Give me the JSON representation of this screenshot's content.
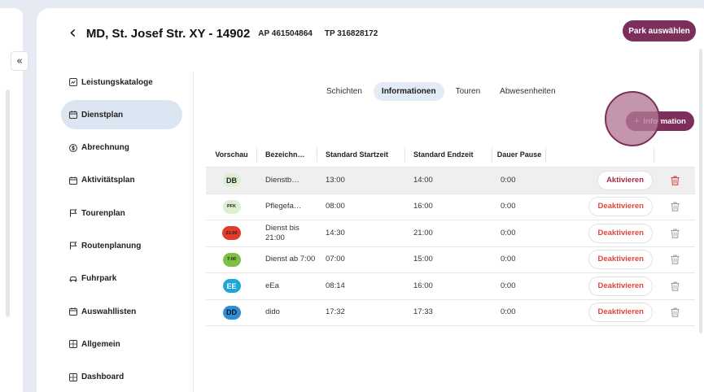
{
  "header": {
    "title": "MD, St. Josef Str. XY - 14902",
    "ap": "AP 461504864",
    "tp": "TP 316828172",
    "park_button": "Park auswählen"
  },
  "collapse_label": "«",
  "back_label": "‹",
  "sidebar": {
    "items": [
      {
        "label": "Leistungskataloge",
        "icon": "catalog-icon",
        "active": false
      },
      {
        "label": "Dienstplan",
        "icon": "calendar-icon",
        "active": true
      },
      {
        "label": "Abrechnung",
        "icon": "dollar-icon",
        "active": false
      },
      {
        "label": "Aktivitätsplan",
        "icon": "calendar-icon",
        "active": false
      },
      {
        "label": "Tourenplan",
        "icon": "flag-icon",
        "active": false
      },
      {
        "label": "Routenplanung",
        "icon": "flag-icon",
        "active": false
      },
      {
        "label": "Fuhrpark",
        "icon": "car-icon",
        "active": false
      },
      {
        "label": "Auswahllisten",
        "icon": "calendar-icon",
        "active": false
      },
      {
        "label": "Allgemein",
        "icon": "grid-icon",
        "active": false
      },
      {
        "label": "Dashboard",
        "icon": "grid-icon",
        "active": false
      }
    ]
  },
  "tabs": [
    {
      "label": "Schichten",
      "active": false
    },
    {
      "label": "Informationen",
      "active": true
    },
    {
      "label": "Touren",
      "active": false
    },
    {
      "label": "Abwesenheiten",
      "active": false
    }
  ],
  "add_button": {
    "plus": "+",
    "label": "Information"
  },
  "table": {
    "headers": {
      "preview": "Vorschau",
      "name": "Bezeichn…",
      "start": "Standard Startzeit",
      "end": "Standard Endzeit",
      "pause": "Dauer Pause"
    },
    "rows": [
      {
        "badge": "DB",
        "badge_bg": "#dcefd0",
        "badge_fg": "#222222",
        "badge_small": false,
        "name": "Dienstb…",
        "start": "13:00",
        "end": "14:00",
        "pause": "0:00",
        "action": "Aktivieren",
        "action_type": "activate",
        "highlight": true,
        "trash_color": "#d23b3b"
      },
      {
        "badge": "PFK",
        "badge_bg": "#dcefd0",
        "badge_fg": "#222222",
        "badge_small": true,
        "name": "Pflegefa…",
        "start": "08:00",
        "end": "16:00",
        "pause": "0:00",
        "action": "Deaktivieren",
        "action_type": "deactivate",
        "highlight": false,
        "trash_color": "#9a9a9a"
      },
      {
        "badge": "21:00",
        "badge_bg": "#e23b2e",
        "badge_fg": "#222222",
        "badge_small": true,
        "name": "Dienst bis 21:00",
        "start": "14:30",
        "end": "21:00",
        "pause": "0:00",
        "action": "Deaktivieren",
        "action_type": "deactivate",
        "highlight": false,
        "trash_color": "#9a9a9a"
      },
      {
        "badge": "7:00",
        "badge_bg": "#7ec041",
        "badge_fg": "#222222",
        "badge_small": true,
        "name": "Dienst ab 7:00",
        "start": "07:00",
        "end": "15:00",
        "pause": "0:00",
        "action": "Deaktivieren",
        "action_type": "deactivate",
        "highlight": false,
        "trash_color": "#9a9a9a"
      },
      {
        "badge": "EE",
        "badge_bg": "#1ea7d4",
        "badge_fg": "#ffffff",
        "badge_small": false,
        "name": "eEa",
        "start": "08:14",
        "end": "16:00",
        "pause": "0:00",
        "action": "Deaktivieren",
        "action_type": "deactivate",
        "highlight": false,
        "trash_color": "#9a9a9a"
      },
      {
        "badge": "DD",
        "badge_bg": "#2d8fd8",
        "badge_fg": "#111111",
        "badge_small": false,
        "name": "dido",
        "start": "17:32",
        "end": "17:33",
        "pause": "0:00",
        "action": "Deaktivieren",
        "action_type": "deactivate",
        "highlight": false,
        "trash_color": "#9a9a9a"
      }
    ]
  },
  "colors": {
    "accent": "#7b2f5a",
    "active_nav": "#dce6f3",
    "deactivate": "#e0463c",
    "activate": "#a32c48"
  }
}
